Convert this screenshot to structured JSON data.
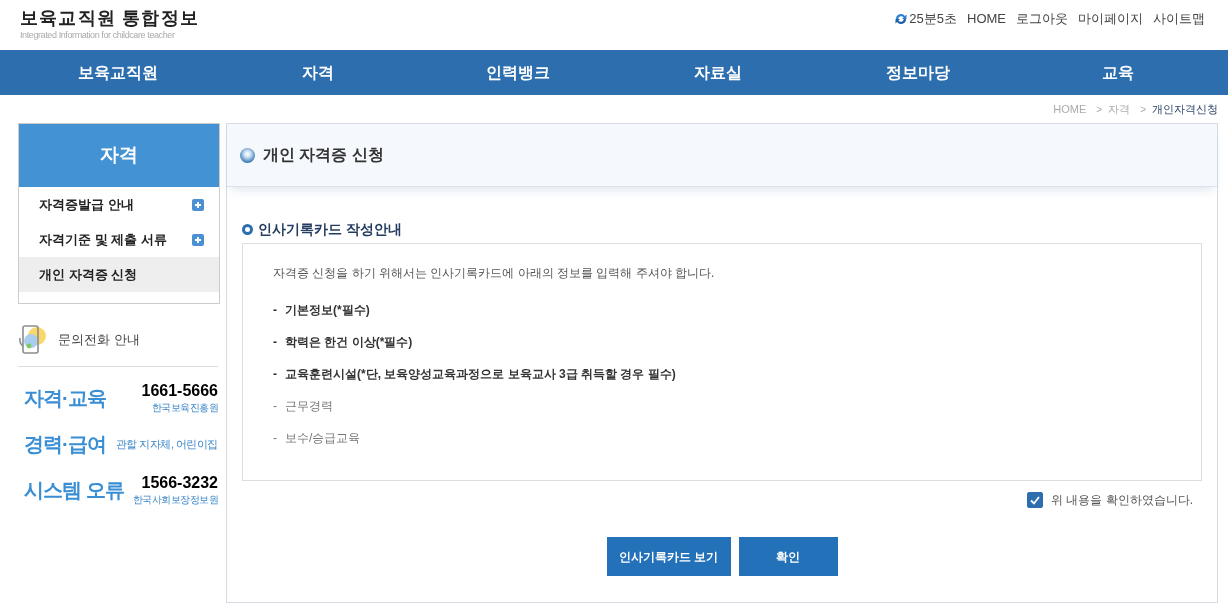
{
  "header": {
    "site_title": "보육교직원 통합정보",
    "site_subtitle": "Integrated Information for childcare teacher",
    "session_timer": "25분5초",
    "utility_links": [
      "HOME",
      "로그아웃",
      "마이페이지",
      "사이트맵"
    ]
  },
  "nav": {
    "items": [
      "보육교직원",
      "자격",
      "인력뱅크",
      "자료실",
      "정보마당",
      "교육"
    ]
  },
  "breadcrumb": [
    {
      "label": "HOME",
      "current": false
    },
    {
      "separator": ">",
      "label": "자격",
      "current": false
    },
    {
      "separator": ">",
      "label": "개인자격신청",
      "current": true
    }
  ],
  "sidebar": {
    "title": "자격",
    "items": [
      {
        "label": "자격증발급 안내",
        "expandable": true,
        "selected": false
      },
      {
        "label": "자격기준 및 제출 서류",
        "expandable": true,
        "selected": false
      },
      {
        "label": "개인 자격증 신청",
        "expandable": false,
        "selected": true
      }
    ]
  },
  "contact": {
    "title": "문의전화 안내",
    "entries": [
      {
        "category": "자격·교육",
        "phone": "1661-5666",
        "organization": "한국보육진흥원"
      },
      {
        "category": "경력·급여",
        "organization": "관할 지자체, 어린이집"
      },
      {
        "category": "시스템 오류",
        "phone": "1566-3232",
        "organization": "한국사회보장정보원"
      }
    ]
  },
  "main": {
    "page_title": "개인 자격증 신청",
    "section_title": "인사기록카드 작성안내",
    "intro": "자격증 신청을 하기 위해서는 인사기록카드에 아래의 정보를 입력해 주셔야 합니다.",
    "requirements": [
      {
        "bullet": "-",
        "text": "기본정보(*필수)",
        "emphasized": true
      },
      {
        "bullet": "-",
        "text": "학력은 한건 이상(*필수)",
        "emphasized": true
      },
      {
        "bullet": "-",
        "text": "교육훈련시설(*단, 보육양성교육과정으로 보육교사 3급 취득할 경우 필수)",
        "emphasized": true
      },
      {
        "bullet": "-",
        "text": "근무경력",
        "emphasized": false
      },
      {
        "bullet": "-",
        "text": "보수/승급교육",
        "emphasized": false
      }
    ],
    "confirmation": {
      "label": "위 내용을 확인하였습니다.",
      "checked": true
    },
    "buttons": [
      "인사기록카드 보기",
      "확인"
    ]
  }
}
